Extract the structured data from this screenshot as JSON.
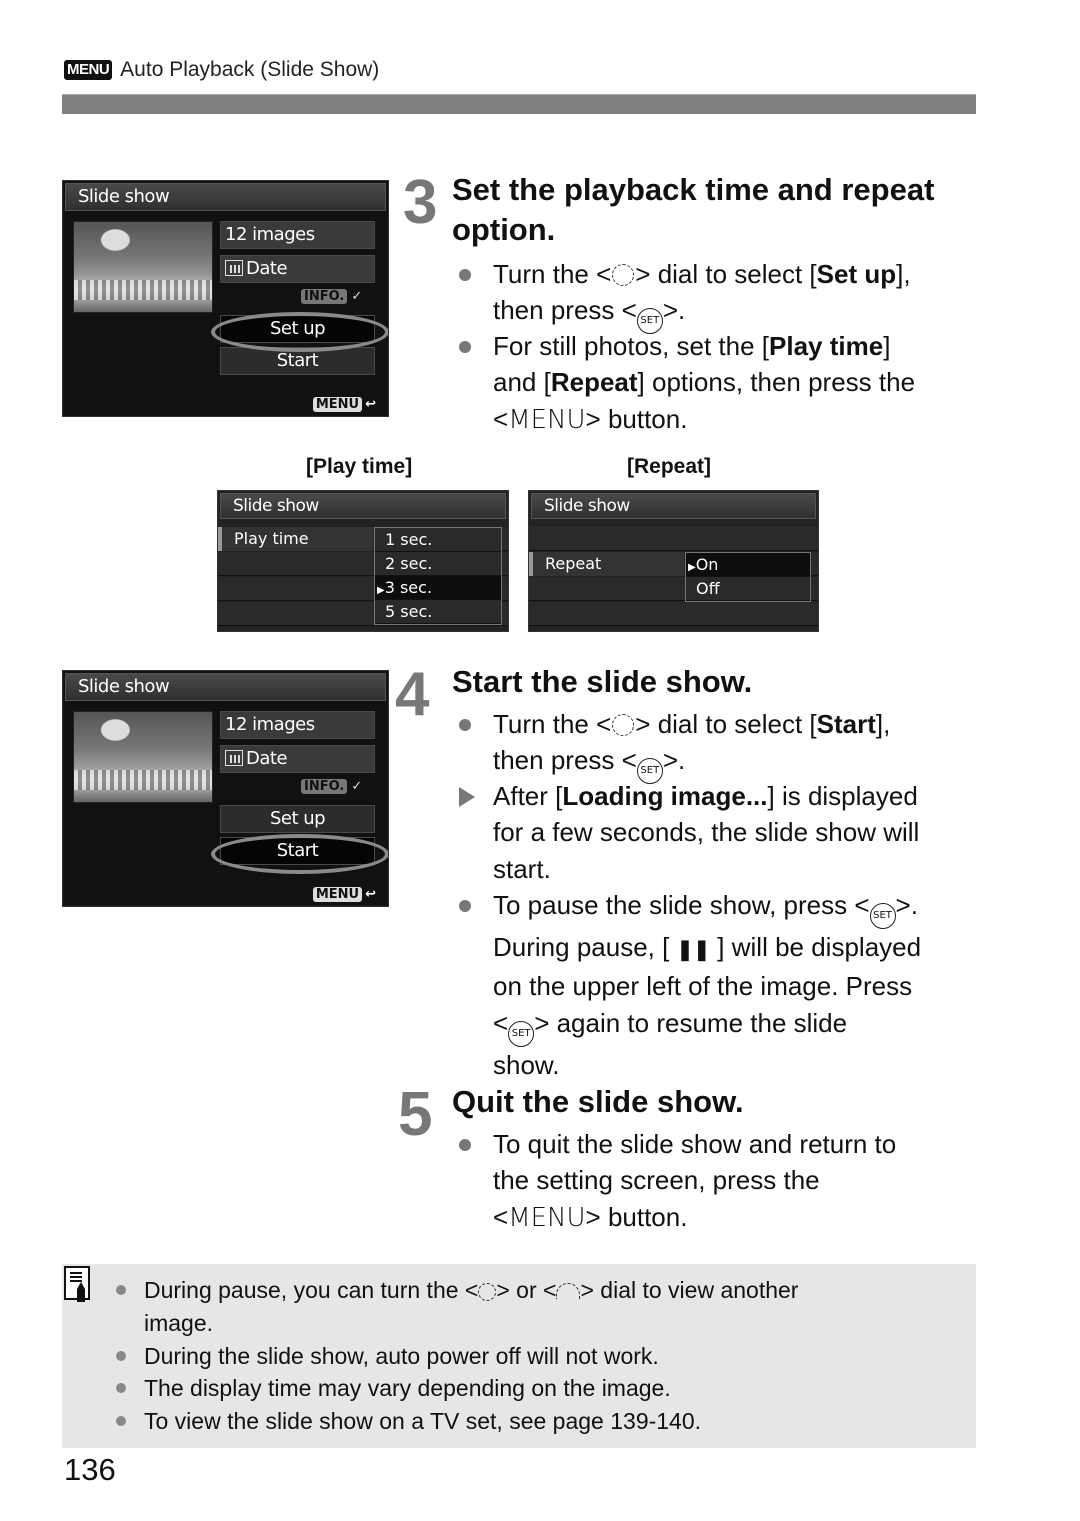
{
  "header": {
    "menu_tag": "MENU",
    "title": "Auto Playback (Slide Show)"
  },
  "screen_setup": {
    "title": "Slide show",
    "images": "12 images",
    "sort": "Date",
    "info_tag": "INFO.",
    "setup": "Set up",
    "start": "Start",
    "back_tag": "MENU",
    "back_symbol": "↩",
    "highlighted": "Set up"
  },
  "step3": {
    "number": "3",
    "heading": "Set the playback time and repeat option.",
    "b1_pre": "Turn the <",
    "b1_mid": "> dial to select [",
    "b1_bold": "Set up",
    "b1_post": "],",
    "b1_line2_pre": "then press <",
    "b1_line2_post": ">.",
    "b2_pre": "For still photos, set the [",
    "b2_bold1": "Play time",
    "b2_mid": "]",
    "b2_line2_pre": "and [",
    "b2_bold2": "Repeat",
    "b2_line2_post": "] options, then press the",
    "b2_line3_pre": "<",
    "b2_menu": "MENU",
    "b2_line3_post": "> button.",
    "set_label": "SET"
  },
  "captions": {
    "play_time": "[Play time]",
    "repeat": "[Repeat]"
  },
  "screen_playtime": {
    "title": "Slide show",
    "label": "Play time",
    "options": [
      "1 sec.",
      "2 sec.",
      "3 sec.",
      "5 sec."
    ],
    "selected": "3 sec.",
    "selected_marker": "▶"
  },
  "screen_repeat": {
    "title": "Slide show",
    "label": "Repeat",
    "options": [
      "On",
      "Off"
    ],
    "selected": "On",
    "selected_marker": "▶"
  },
  "screen_start": {
    "title": "Slide show",
    "images": "12 images",
    "sort": "Date",
    "info_tag": "INFO.",
    "setup": "Set up",
    "start": "Start",
    "back_tag": "MENU",
    "back_symbol": "↩",
    "highlighted": "Start"
  },
  "step4": {
    "number": "4",
    "heading": "Start the slide show.",
    "b1_pre": "Turn the <",
    "b1_mid": "> dial to select [",
    "b1_bold": "Start",
    "b1_post": "],",
    "b1_line2_pre": "then press <",
    "b1_line2_post": ">.",
    "b2_pre": "After [",
    "b2_bold": "Loading image...",
    "b2_post": "] is displayed",
    "b2_line2": "for a few seconds, the slide show will",
    "b2_line3": "start.",
    "b3_pre": "To pause the slide show, press <",
    "b3_post": ">.",
    "b3_line2_pre": "During pause, [ ",
    "b3_pause": "❚❚",
    "b3_line2_post": " ] will be displayed",
    "b3_line3": "on the upper left of the image. Press",
    "b3_line4_pre": "<",
    "b3_line4_post": "> again to resume the slide",
    "b3_line5": "show.",
    "set_label": "SET"
  },
  "step5": {
    "number": "5",
    "heading": "Quit the slide show.",
    "b1_line1": "To quit the slide show and return to",
    "b1_line2": "the setting screen, press the",
    "b1_line3_pre": "<",
    "b1_menu": "MENU",
    "b1_line3_post": "> button."
  },
  "notes": {
    "n1_pre": "During pause, you can turn the <",
    "n1_mid": "> or <",
    "n1_post": "> dial to view another",
    "n1_line2": "image.",
    "n2": "During the slide show, auto power off will not work.",
    "n3": "The display time may vary depending on the image.",
    "n4": "To view the slide show on a TV set, see page 139-140."
  },
  "page_number": "136"
}
